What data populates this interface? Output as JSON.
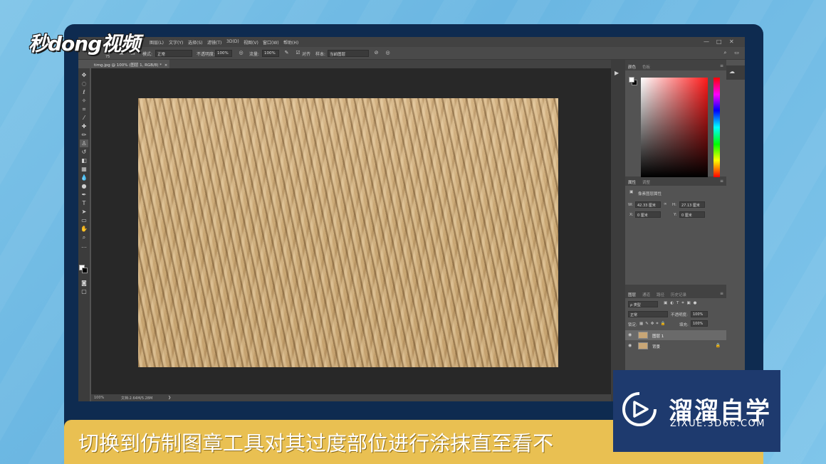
{
  "watermark": {
    "logo_text": "秒dong视频"
  },
  "menubar": {
    "items": [
      "图层(L)",
      "文字(Y)",
      "选择(S)",
      "滤镜(T)",
      "3D(D)",
      "视图(V)",
      "窗口(W)",
      "帮助(H)"
    ],
    "window_controls": [
      "—",
      "□",
      "✕"
    ]
  },
  "options_bar": {
    "brush_size": "75",
    "mode_label": "模式:",
    "mode_value": "正常",
    "opacity_label": "不透明度:",
    "opacity_value": "100%",
    "flow_label": "流量:",
    "flow_value": "100%",
    "aligned_label": "对齐",
    "sample_label": "样本:",
    "sample_value": "当前图层"
  },
  "document": {
    "tab_title": "timg.jpg @ 100% (图层 1, RGB/8) *",
    "close": "×"
  },
  "status_bar": {
    "zoom": "100%",
    "doc_info": "文档:2.64M/5.28M"
  },
  "color_panel": {
    "tabs": [
      "颜色",
      "色板"
    ]
  },
  "properties_panel": {
    "tabs": [
      "属性",
      "调整"
    ],
    "title": "像素图层属性",
    "w_label": "W:",
    "w_value": "42.33 厘米",
    "link_icon": "∞",
    "h_label": "H:",
    "h_value": "27.13 厘米",
    "x_label": "X:",
    "x_value": "0 厘米",
    "y_label": "Y:",
    "y_value": "0 厘米"
  },
  "layers_panel": {
    "tabs": [
      "图层",
      "通道",
      "路径",
      "历史记录"
    ],
    "filter_label": "ρ 类型",
    "blend_mode": "正常",
    "opacity_label": "不透明度:",
    "opacity_value": "100%",
    "lock_label": "锁定:",
    "fill_label": "填充:",
    "fill_value": "100%",
    "layers": [
      {
        "name": "图层 1",
        "selected": true
      },
      {
        "name": "背景",
        "selected": false
      }
    ]
  },
  "subtitle": "切换到仿制图章工具对其过度部位进行涂抹直至看不",
  "brand": {
    "name": "溜溜自学",
    "url": "ZIXUE.3D66.COM"
  },
  "colors": {
    "accent_yellow": "#e9c052",
    "frame_navy": "#0e2b50",
    "brand_blue": "#1e3a6e",
    "sand": "#c8a676"
  }
}
